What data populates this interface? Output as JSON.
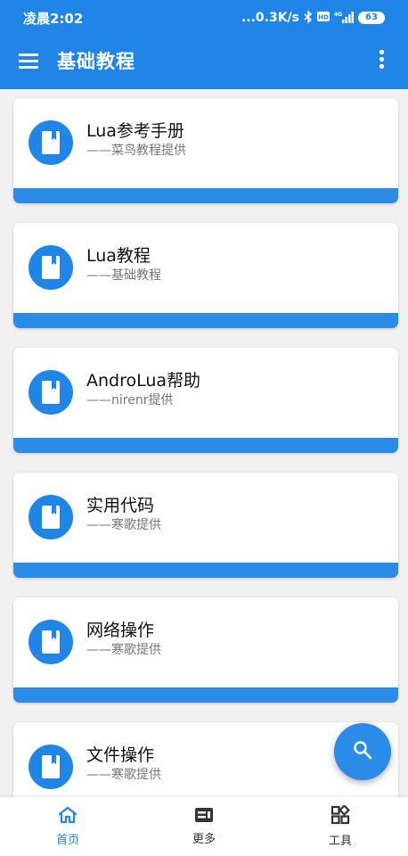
{
  "status_bar": {
    "time": "凌晨2:02",
    "net_speed": "...0.3K/s",
    "icons": [
      "bluetooth-icon",
      "hd-icon",
      "4g-signal-icon"
    ],
    "battery": "63"
  },
  "toolbar": {
    "title": "基础教程",
    "menu_icon": "hamburger-menu-icon",
    "more_icon": "more-vert-icon"
  },
  "cards": [
    {
      "title": "Lua参考手册",
      "subtitle": "——菜鸟教程提供",
      "icon": "book-icon"
    },
    {
      "title": "Lua教程",
      "subtitle": "——基础教程",
      "icon": "book-icon"
    },
    {
      "title": "AndroLua帮助",
      "subtitle": "——nirenr提供",
      "icon": "book-icon"
    },
    {
      "title": "实用代码",
      "subtitle": "——寒歌提供",
      "icon": "book-icon"
    },
    {
      "title": "网络操作",
      "subtitle": "——寒歌提供",
      "icon": "book-icon"
    },
    {
      "title": "文件操作",
      "subtitle": "——寒歌提供",
      "icon": "book-icon"
    }
  ],
  "fab": {
    "icon": "search-icon"
  },
  "bottom_nav": [
    {
      "label": "首页",
      "icon": "home-icon",
      "active": true
    },
    {
      "label": "更多",
      "icon": "dashboard-icon",
      "active": false
    },
    {
      "label": "工具",
      "icon": "apps-icon",
      "active": false
    }
  ],
  "colors": {
    "primary": "#1f86e7",
    "card_bar": "#2b8ce8",
    "background": "#f1f1f1"
  }
}
